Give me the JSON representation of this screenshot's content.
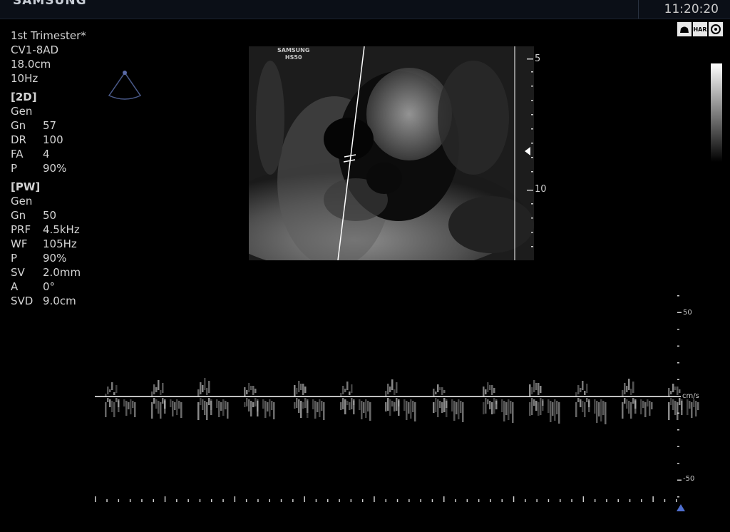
{
  "header": {
    "brand": "SAMSUNG",
    "time": "11:20:20"
  },
  "status_icons": [
    {
      "name": "probe-icon",
      "label": ""
    },
    {
      "name": "har-icon",
      "label": "HAR"
    },
    {
      "name": "settings-icon",
      "label": ""
    }
  ],
  "study": {
    "preset": "1st Trimester*",
    "probe": "CV1-8AD",
    "depth": "18.0cm",
    "frame_rate": "10Hz"
  },
  "mode_2d": {
    "title": "[2D]",
    "gen": "Gen",
    "params": [
      {
        "k": "Gn",
        "v": "57"
      },
      {
        "k": "DR",
        "v": "100"
      },
      {
        "k": "FA",
        "v": "4"
      },
      {
        "k": "P",
        "v": "90%"
      }
    ]
  },
  "mode_pw": {
    "title": "[PW]",
    "gen": "Gen",
    "params": [
      {
        "k": "Gn",
        "v": "50"
      },
      {
        "k": "PRF",
        "v": "4.5kHz"
      },
      {
        "k": "WF",
        "v": "105Hz"
      },
      {
        "k": "P",
        "v": "90%"
      },
      {
        "k": "SV",
        "v": "2.0mm"
      },
      {
        "k": "A",
        "v": "0°"
      },
      {
        "k": "SVD",
        "v": "9.0cm"
      }
    ]
  },
  "image": {
    "label_line1": "SAMSUNG",
    "label_line2": "HS50",
    "depth_marks": [
      "5",
      "10"
    ]
  },
  "doppler": {
    "velocity_top": "50",
    "velocity_bottom": "-50",
    "unit": "cm/s"
  },
  "colors": {
    "accent": "#3a5fbf",
    "background": "#000000"
  }
}
